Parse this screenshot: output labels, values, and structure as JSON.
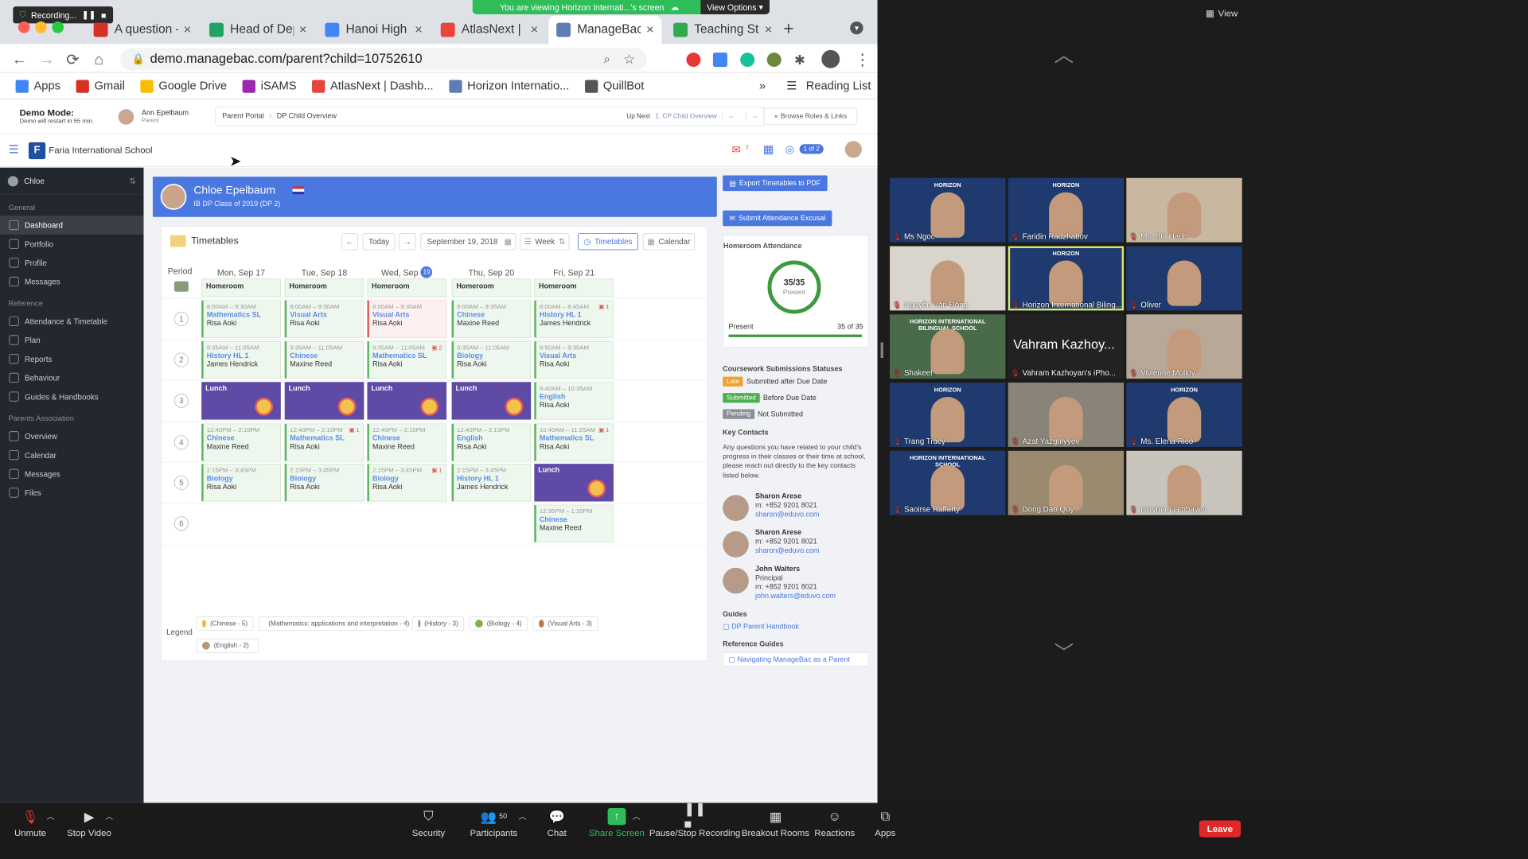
{
  "recording": {
    "label": "Recording..."
  },
  "share_banner": {
    "text": "You are viewing Horizon Internati...'s screen",
    "view_options": "View Options"
  },
  "browser_tabs": [
    {
      "label": "A question -",
      "icon_color": "#d93025",
      "icon": "gmail-icon"
    },
    {
      "label": "Head of Dep",
      "icon_color": "#1fa463",
      "icon": "google-drive-icon"
    },
    {
      "label": "Hanoi High",
      "icon_color": "#4285f4",
      "icon": "google-docs-icon"
    },
    {
      "label": "AtlasNext | L",
      "icon_color": "#e8453c",
      "icon": "atlas-icon"
    },
    {
      "label": "ManageBac",
      "icon_color": "#5f7db3",
      "icon": "managebac-icon",
      "active": true
    },
    {
      "label": "Teaching St",
      "icon_color": "#34a853",
      "icon": "sheets-icon"
    }
  ],
  "address": {
    "url": "demo.managebac.com/parent?child=10752610"
  },
  "bookmarks": [
    {
      "label": "Apps",
      "color": "#4285f4"
    },
    {
      "label": "Gmail",
      "color": "#d93025"
    },
    {
      "label": "Google Drive",
      "color": "#fbbc04"
    },
    {
      "label": "iSAMS",
      "color": "#9c27b0"
    },
    {
      "label": "AtlasNext | Dashb...",
      "color": "#e8453c"
    },
    {
      "label": "Horizon Internatio...",
      "color": "#5f7db3"
    },
    {
      "label": "QuillBot",
      "color": "#555555"
    }
  ],
  "bookmarks_more": "»",
  "reading_list": "Reading List",
  "demo": {
    "title": "Demo Mode:",
    "subtitle": "Demo will restart in 55 min.",
    "user_name": "Ann Epelbaum",
    "user_role": "Parent",
    "breadcrumb": [
      "Parent Portal",
      "DP Child Overview"
    ],
    "up_next_label": "Up Next",
    "up_next_value": "1. CP Child Overview",
    "browse_label": "Browse Roles & Links"
  },
  "app_header": {
    "school": "Faria International School",
    "mail_count": "7",
    "page_indicator": "1 of 2"
  },
  "sidebar": {
    "student": "Chloe",
    "sections": [
      {
        "title": "General",
        "items": [
          "Dashboard",
          "Portfolio",
          "Profile",
          "Messages"
        ]
      },
      {
        "title": "Reference",
        "items": [
          "Attendance & Timetable",
          "Plan",
          "Reports",
          "Behaviour",
          "Guides & Handbooks"
        ]
      },
      {
        "title": "Parents Association",
        "items": [
          "Overview",
          "Calendar",
          "Messages",
          "Files"
        ]
      }
    ]
  },
  "child": {
    "name": "Chloe Epelbaum",
    "class": "IB DP Class of 2019 (DP 2)"
  },
  "timetable": {
    "title": "Timetables",
    "today_label": "Today",
    "date": "September 19, 2018",
    "view": "Week",
    "tab_timetables": "Timetables",
    "tab_calendar": "Calendar",
    "period_label": "Period",
    "days": [
      "Mon, Sep 17",
      "Tue, Sep 18",
      "Wed, Sep",
      "Thu, Sep 20",
      "Fri, Sep 21"
    ],
    "today_badge": "19",
    "homeroom": "Homeroom",
    "lunch": "Lunch",
    "periods": [
      "1",
      "2",
      "3",
      "4",
      "5",
      "6"
    ],
    "rows": [
      [
        {
          "time": "8:00AM – 9:30AM",
          "subject": "Mathematics SL",
          "teacher": "Risa Aoki"
        },
        {
          "time": "8:00AM – 9:30AM",
          "subject": "Visual Arts",
          "teacher": "Risa Aoki"
        },
        {
          "time": "8:00AM – 9:30AM",
          "subject": "Visual Arts",
          "teacher": "Risa Aoki",
          "alert": true
        },
        {
          "time": "8:00AM – 9:35AM",
          "subject": "Chinese",
          "teacher": "Maxine Reed"
        },
        {
          "time": "8:00AM – 8:45AM",
          "subject": "History HL 1",
          "teacher": "James Hendrick",
          "flag": "1"
        }
      ],
      [
        {
          "time": "9:35AM – 11:05AM",
          "subject": "History HL 1",
          "teacher": "James Hendrick"
        },
        {
          "time": "9:35AM – 11:05AM",
          "subject": "Chinese",
          "teacher": "Maxine Reed"
        },
        {
          "time": "9:35AM – 11:05AM",
          "subject": "Mathematics SL",
          "teacher": "Risa Aoki",
          "flag": "2"
        },
        {
          "time": "9:35AM – 11:05AM",
          "subject": "Biology",
          "teacher": "Risa Aoki"
        },
        {
          "time": "8:50AM – 9:35AM",
          "subject": "Visual Arts",
          "teacher": "Risa Aoki"
        }
      ],
      [
        {
          "lunch": true
        },
        {
          "lunch": true
        },
        {
          "lunch": true
        },
        {
          "lunch": true
        },
        {
          "time": "9:40AM – 10:35AM",
          "subject": "English",
          "teacher": "Risa Aoki"
        }
      ],
      [
        {
          "time": "12:40PM – 2:10PM",
          "subject": "Chinese",
          "teacher": "Maxine Reed"
        },
        {
          "time": "12:40PM – 2:10PM",
          "subject": "Mathematics SL",
          "teacher": "Risa Aoki",
          "flag": "1"
        },
        {
          "time": "12:40PM – 2:10PM",
          "subject": "Chinese",
          "teacher": "Maxine Reed"
        },
        {
          "time": "12:40PM – 2:10PM",
          "subject": "English",
          "teacher": "Risa Aoki"
        },
        {
          "time": "10:40AM – 11:25AM",
          "subject": "Mathematics SL",
          "teacher": "Risa Aoki",
          "flag": "1"
        }
      ],
      [
        {
          "time": "2:15PM – 3:45PM",
          "subject": "Biology",
          "teacher": "Risa Aoki"
        },
        {
          "time": "2:15PM – 3:45PM",
          "subject": "Biology",
          "teacher": "Risa Aoki"
        },
        {
          "time": "2:15PM – 3:45PM",
          "subject": "Biology",
          "teacher": "Risa Aoki",
          "flag": "1"
        },
        {
          "time": "2:15PM – 3:45PM",
          "subject": "History HL 1",
          "teacher": "James Hendrick"
        },
        {
          "lunch": true
        }
      ],
      [
        null,
        null,
        null,
        null,
        {
          "time": "12:35PM – 1:20PM",
          "subject": "Chinese",
          "teacher": "Maxine Reed"
        }
      ]
    ],
    "legend_label": "Legend",
    "legend": [
      {
        "label": "(Chinese - 5)",
        "color": "#f0b93b"
      },
      {
        "label": "(Mathematics: applications and interpretation - 4)",
        "color": "#e07b5c"
      },
      {
        "label": "(History - 3)",
        "color": "#9aa0a6"
      },
      {
        "label": "(Biology - 4)",
        "color": "#7cb342"
      },
      {
        "label": "(Visual Arts - 3)",
        "color": "#c0734a"
      },
      {
        "label": "(English - 2)",
        "color": "#b59a7a"
      }
    ]
  },
  "right_panel": {
    "export_btn": "Export Timetables to PDF",
    "attendance_btn": "Submit Attendance Excusal",
    "homeroom_title": "Homeroom Attendance",
    "attendance_value": "35/35",
    "attendance_label": "Present",
    "attendance_fraction": 1.0,
    "present_label": "Present",
    "present_count": "35 of 35",
    "coursework_title": "Coursework Submissions Statuses",
    "statuses": [
      {
        "badge": "Late",
        "text": "Submitted after Due Date",
        "color": "#f0a030"
      },
      {
        "badge": "Submitted",
        "text": "Before Due Date",
        "color": "#4caf50"
      },
      {
        "badge": "Pending",
        "text": "Not Submitted",
        "color": "#8a9099"
      }
    ],
    "contacts_title": "Key Contacts",
    "contacts_text": "Any questions you have related to your child's progress in their classes or their time at school, please reach out directly to the key contacts listed below.",
    "contacts": [
      {
        "name": "Sharon Arese",
        "role": "",
        "phone": "m: +852 9201 8021",
        "email": "sharon@eduvo.com"
      },
      {
        "name": "Sharon Arese",
        "role": "",
        "phone": "m: +852 9201 8021",
        "email": "sharon@eduvo.com"
      },
      {
        "name": "John Walters",
        "role": "Principal",
        "phone": "m: +852 9201 8021",
        "email": "john.walters@eduvo.com"
      }
    ],
    "guides_title": "Guides",
    "guide_link": "DP Parent Handbook",
    "ref_title": "Reference Guides",
    "ref_link": "Navigating ManageBac as a Parent"
  },
  "gallery": {
    "view_label": "View",
    "participants": [
      {
        "name": "Ms Ngoc",
        "bg": "#1f3a6e",
        "logo": "HORIZON"
      },
      {
        "name": "Faridin Radzhabov",
        "bg": "#1f3a6e",
        "logo": "HORIZON"
      },
      {
        "name": "Ms. Bùi Hạnh",
        "bg": "#c9b8a0",
        "logo": ""
      },
      {
        "name": "Nguyễn Văn Đông",
        "bg": "#d9d4cc",
        "logo": ""
      },
      {
        "name": "Horizon International Biling...",
        "bg": "#1f3a6e",
        "logo": "HORIZON",
        "highlight": true
      },
      {
        "name": "Oliver",
        "bg": "#1f3a6e",
        "logo": ""
      },
      {
        "name": "Shakeel",
        "bg": "#4a6b4a",
        "logo": "HORIZON INTERNATIONAL BILINGUAL SCHOOL"
      },
      {
        "name": "Vahram Kazhoyan's iPho...",
        "bg": "#222222",
        "logo": "",
        "text_tile": "Vahram Kazhoy..."
      },
      {
        "name": "Vivienne Molloy",
        "bg": "#b8a898",
        "logo": ""
      },
      {
        "name": "Trang Tracy",
        "bg": "#1f3a6e",
        "logo": "HORIZON"
      },
      {
        "name": "Azat Yazgulyyev",
        "bg": "#8a8478",
        "logo": ""
      },
      {
        "name": "Ms. Elena Rico",
        "bg": "#1f3a6e",
        "logo": "HORIZON"
      },
      {
        "name": "Saoirse Rafferty",
        "bg": "#1f3a6e",
        "logo": "HORIZON INTERNATIONAL SCHOOL"
      },
      {
        "name": "Dong Dao Quy",
        "bg": "#9a8a70",
        "logo": ""
      },
      {
        "name": "naryman jambayev",
        "bg": "#c8c4bc",
        "logo": ""
      }
    ]
  },
  "zoom_toolbar": {
    "unmute": "Unmute",
    "stop_video": "Stop Video",
    "security": "Security",
    "participants": "Participants",
    "participants_count": "50",
    "chat": "Chat",
    "share_screen": "Share Screen",
    "pause_recording": "Pause/Stop Recording",
    "breakout": "Breakout Rooms",
    "reactions": "Reactions",
    "apps": "Apps",
    "leave": "Leave"
  }
}
